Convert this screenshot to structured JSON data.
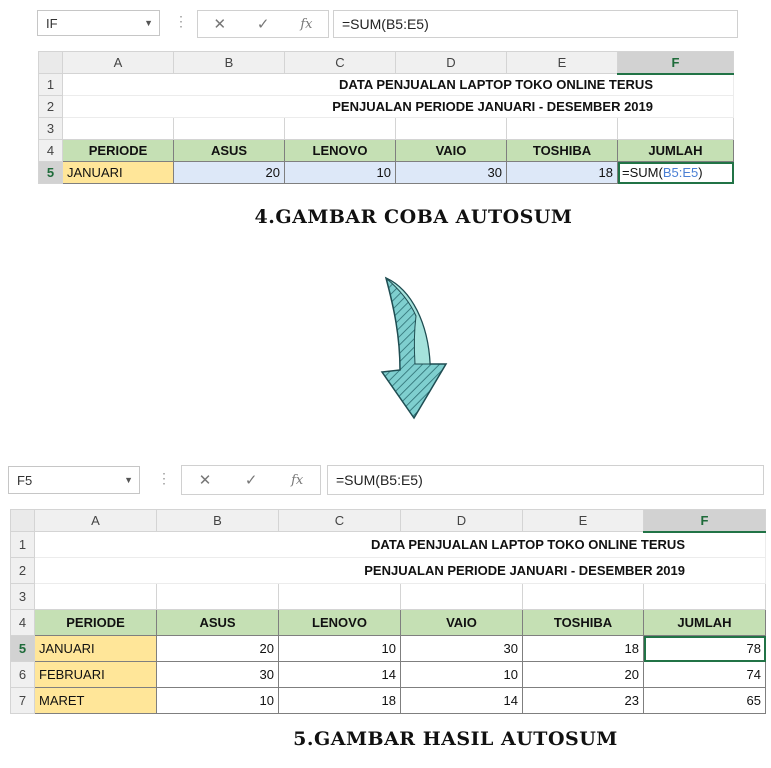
{
  "top": {
    "namebox": "IF",
    "formula": "=SUM(B5:E5)",
    "cols": [
      "A",
      "B",
      "C",
      "D",
      "E",
      "F"
    ],
    "rows": [
      "1",
      "2",
      "3",
      "4",
      "5"
    ],
    "title1": "DATA PENJUALAN LAPTOP TOKO ONLINE TERUS",
    "title2": "PENJUALAN PERIODE JANUARI - DESEMBER 2019",
    "headers": [
      "PERIODE",
      "ASUS",
      "LENOVO",
      "VAIO",
      "TOSHIBA",
      "JUMLAH"
    ],
    "row5": {
      "periode": "JANUARI",
      "asus": "20",
      "lenovo": "10",
      "vaio": "30",
      "toshiba": "18",
      "formula_prefix": "=SUM(",
      "formula_ref": "B5:E5",
      "formula_suffix": ")"
    },
    "caption": "4.GAMBAR COBA AUTOSUM"
  },
  "bottom": {
    "namebox": "F5",
    "formula": "=SUM(B5:E5)",
    "cols": [
      "A",
      "B",
      "C",
      "D",
      "E",
      "F"
    ],
    "rows": [
      "1",
      "2",
      "3",
      "4",
      "5",
      "6",
      "7"
    ],
    "title1": "DATA PENJUALAN LAPTOP TOKO ONLINE TERUS",
    "title2": "PENJUALAN PERIODE JANUARI - DESEMBER 2019",
    "headers": [
      "PERIODE",
      "ASUS",
      "LENOVO",
      "VAIO",
      "TOSHIBA",
      "JUMLAH"
    ],
    "data": [
      [
        "JANUARI",
        "20",
        "10",
        "30",
        "18",
        "78"
      ],
      [
        "FEBRUARI",
        "30",
        "14",
        "10",
        "20",
        "74"
      ],
      [
        "MARET",
        "10",
        "18",
        "14",
        "23",
        "65"
      ]
    ],
    "caption": "5.GAMBAR HASIL AUTOSUM"
  },
  "icons": {
    "cancel": "✕",
    "enter": "✓",
    "fx": "fx",
    "dropdown": "▼",
    "dots": "⋮"
  }
}
